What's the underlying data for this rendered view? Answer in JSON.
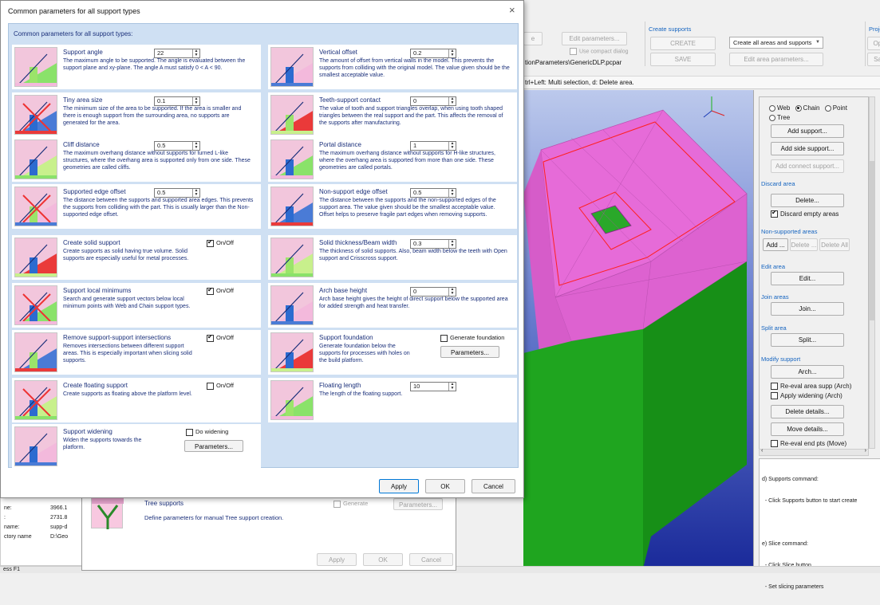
{
  "app": {
    "create_supports": {
      "group_label": "Create supports",
      "create_btn": "CREATE",
      "save_btn": "SAVE",
      "dropdown_value": "Create all areas and supports",
      "edit_area_params_btn": "Edit area parameters..."
    },
    "project": {
      "group_label": "Project",
      "btn1": "Ope",
      "btn2": "Sav"
    },
    "edit_params_btn": "Edit parameters...",
    "compact_dialog_label": "Use compact dialog",
    "btn_stub": "e",
    "path_text": "tionParameters\\GenericDLP.pcpar",
    "hint_text": "trl+Left: Multi selection, d: Delete area.",
    "status_text": "ess F1"
  },
  "right_panel": {
    "radio_web": "Web",
    "radio_chain": "Chain",
    "radio_point": "Point",
    "radio_tree": "Tree",
    "add_support": "Add support...",
    "add_side_support": "Add side support...",
    "add_connect_support": "Add connect support...",
    "discard_area_label": "Discard area",
    "delete_btn": "Delete...",
    "discard_empty": "Discard empty areas",
    "non_supported_label": "Non-supported areas",
    "add_btn": "Add ...",
    "delete_small": "Delete ...",
    "delete_all": "Delete All",
    "edit_area_label": "Edit area",
    "edit_btn": "Edit...",
    "join_label": "Join areas",
    "join_btn": "Join...",
    "split_label": "Split area",
    "split_btn": "Split...",
    "modify_label": "Modify support",
    "arch_btn": "Arch...",
    "reeval_arch": "Re-eval area supp (Arch)",
    "apply_widening": "Apply widening (Arch)",
    "delete_details": "Delete details...",
    "move_details": "Move details...",
    "reeval_end": "Re-eval end pts (Move)",
    "help_lines": [
      "d) Supports command:",
      "  - Click Supports button to start create",
      "",
      "e) Slice command:",
      "  - Click Slice button",
      "  - Set slicing parameters"
    ]
  },
  "info_table": {
    "labels": [
      "ne:",
      ":",
      "name:",
      "ctory name"
    ],
    "values": [
      "3966.1",
      "2731.8",
      "supp-d",
      "D:\\Geo"
    ]
  },
  "back_dialog": {
    "title": "Tree supports",
    "description": "Define parameters for manual Tree support creation.",
    "generate": "Generate",
    "parameters": "Parameters...",
    "apply": "Apply",
    "ok": "OK",
    "cancel": "Cancel"
  },
  "dialog": {
    "title": "Common parameters for all support types",
    "header": "Common parameters for all support types:",
    "close": "×",
    "apply": "Apply",
    "ok": "OK",
    "cancel": "Cancel",
    "params": [
      {
        "title": "Support angle",
        "value": "22",
        "desc": "The maximum angle to be supported. The angle is evaluated between the support plane and xy-plane. The angle A must satisfy 0 < A < 90."
      },
      {
        "title": "Vertical offset",
        "value": "0.2",
        "desc": "The amount of offset from vertical walls in the model. This prevents the supports from colliding with the original model. The value given should be the smallest acceptable value."
      },
      {
        "title": "Tiny area size",
        "value": "0.1",
        "desc": "The minimum size of the area to be supported. If the area is smaller and there is enough support from the surrounding area, no supports are generated for the area."
      },
      {
        "title": "Teeth-support contact",
        "value": "0",
        "desc": "The value of tooth and support triangles overlap, when using tooth shaped triangles between the real support and the part. This affects the removal of the supports after manufacturing."
      },
      {
        "title": "Cliff distance",
        "value": "0.5",
        "desc": "The maximum overhang distance without supports for turned L-like structures, where the overhang area is supported only from one side. These geometries are called cliffs."
      },
      {
        "title": "Portal distance",
        "value": "1",
        "desc": "The maximum overhang distance without supports for H-like structures, where the overhang area is supported from more than one side. These geometries are called portals."
      },
      {
        "title": "Supported edge offset",
        "value": "0.5",
        "desc": "The distance between the supports and supported area edges. This prevents the supports from colliding with the part. This is usually larger than the Non-supported edge offset."
      },
      {
        "title": "Non-support edge offset",
        "value": "0.5",
        "desc": "The distance between the supports and the non-supported edges of the support area. The value given should be the smallest acceptable value. Offset helps to preserve fragile part edges when removing supports."
      },
      {
        "title": "Create solid support",
        "toggle": "On/Off",
        "desc": "Create supports as solid having true volume. Solid supports are especially useful for metal processes."
      },
      {
        "title": "Solid thickness/Beam width",
        "value": "0.3",
        "desc": "The thickness of solid supports. Also, beam width below the teeth with Open support and Crisscross support."
      },
      {
        "title": "Support local minimums",
        "toggle": "On/Off",
        "desc": "Search and generate support vectors below local minimum points with Web and Chain support types."
      },
      {
        "title": "Arch base height",
        "value": "0",
        "desc": "Arch base height gives the height of direct support below the supported area for added strength and heat transfer."
      },
      {
        "title": "Remove support-support intersections",
        "toggle": "On/Off",
        "desc": "Removes intersections between different support areas. This is especially important when slicing solid supports."
      },
      {
        "title": "Support foundation",
        "toggle": "Generate foundation",
        "button": "Parameters...",
        "desc": "Generate foundation below the supports for processes with holes on the build platform."
      },
      {
        "title": "Create floating support",
        "toggle": "On/Off",
        "desc": "Create supports as floating above the platform level."
      },
      {
        "title": "Floating length",
        "value": "10",
        "desc": "The length of the floating support."
      },
      {
        "title": "Support widening",
        "toggle": "Do widening",
        "button": "Parameters...",
        "desc": "Widen the supports towards the platform."
      }
    ]
  }
}
